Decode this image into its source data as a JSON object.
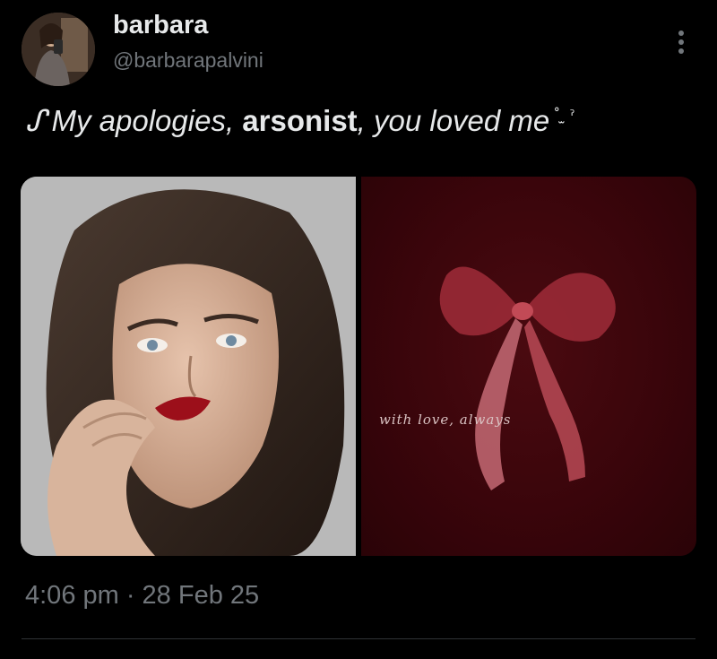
{
  "author": {
    "display_name": "barbara",
    "handle": "@barbarapalvini"
  },
  "tweet": {
    "text_prefix": "ᔑ",
    "text_part1": "My apologies, ",
    "text_bold": "arsonist",
    "text_part2": ", you loved me",
    "text_suffix": "˚ ̫ ˀ"
  },
  "media": {
    "right_caption": "with love, always"
  },
  "meta": {
    "timestamp": "4:06 pm · 28 Feb 25"
  },
  "icons": {
    "more": "more-vertical-icon"
  },
  "colors": {
    "background": "#000000",
    "primary_text": "#e7e9ea",
    "secondary_text": "#71767b",
    "bow_red": "#8b1a24",
    "lipstick": "#a3121c"
  }
}
